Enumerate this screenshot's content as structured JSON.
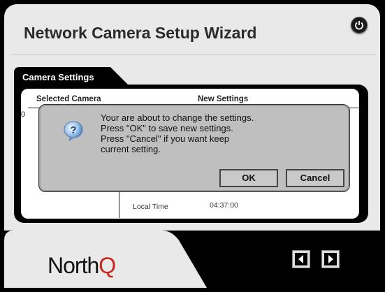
{
  "app": {
    "title": "Network Camera Setup Wizard"
  },
  "icons": {
    "power": "power-icon",
    "question": "question-icon",
    "back": "back-arrow-icon",
    "next": "next-arrow-icon"
  },
  "settings": {
    "tab_label": "Camera Settings",
    "col_selected": "Selected Camera",
    "col_new": "New Settings",
    "row_prefix": "0",
    "local_time_label": "Local Time",
    "local_time_value": "04:37:00"
  },
  "dialog": {
    "line1": "Your are about to change the settings.",
    "line2": "Press \"OK\" to save new settings.",
    "line3": "Press \"Cancel\" if you want keep",
    "line4": "current setting.",
    "ok_label": "OK",
    "cancel_label": "Cancel"
  },
  "brand": {
    "name_prefix": "North",
    "name_suffix": "Q"
  },
  "colors": {
    "brand_q": "#c8261b",
    "dialog_bg": "#bfbfbf"
  }
}
